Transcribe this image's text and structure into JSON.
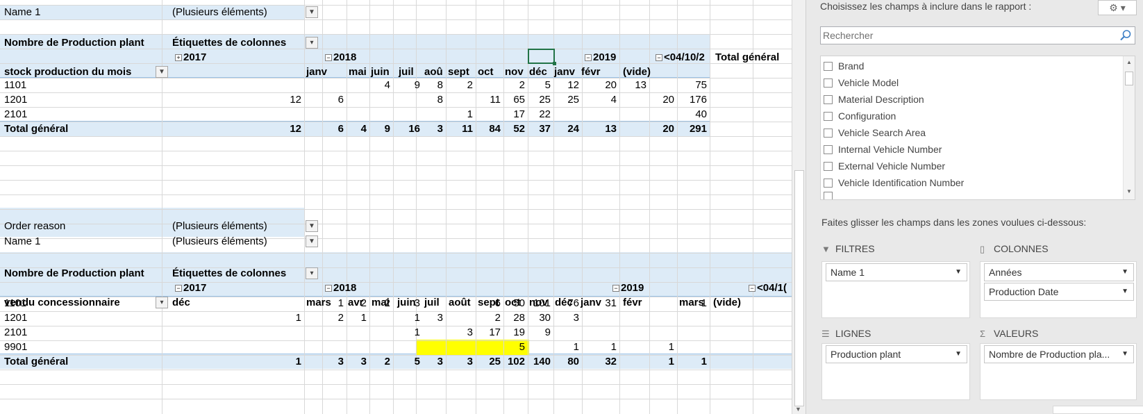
{
  "pivot1": {
    "filter_name": {
      "label": "Name 1",
      "value": "(Plusieurs éléments)"
    },
    "values_label": "Nombre de Production plant",
    "col_labels_caption": "Étiquettes de colonnes",
    "row_header": "stock production du mois",
    "years": {
      "y2017": "2017",
      "y2018": "2018",
      "y2019": "2019",
      "date": "<04/10/2",
      "total": "Total général"
    },
    "months": [
      "janv",
      "mai",
      "juin",
      "juil",
      "aoû",
      "sept",
      "oct",
      "nov",
      "déc",
      "janv",
      "févr",
      "(vide)"
    ],
    "rows": [
      {
        "label": "1101",
        "cells": [
          "",
          "",
          "",
          "4",
          "9",
          "8",
          "2",
          "",
          "2",
          "5",
          "12",
          "20",
          "13",
          "",
          "75"
        ]
      },
      {
        "label": "1201",
        "cells": [
          "12",
          "6",
          "",
          "",
          "",
          "8",
          "",
          "11",
          "65",
          "25",
          "25",
          "4",
          "",
          "20",
          "176"
        ]
      },
      {
        "label": "2101",
        "cells": [
          "",
          "",
          "",
          "",
          "",
          "",
          "1",
          "",
          "17",
          "22",
          "",
          "",
          "",
          "",
          "40"
        ]
      }
    ],
    "total": {
      "label": "Total général",
      "cells": [
        "12",
        "6",
        "4",
        "9",
        "16",
        "3",
        "11",
        "84",
        "52",
        "37",
        "24",
        "13",
        "",
        "20",
        "291"
      ]
    }
  },
  "pivot2": {
    "filter_order": {
      "label": "Order reason",
      "value": "(Plusieurs éléments)"
    },
    "filter_name": {
      "label": "Name 1",
      "value": "(Plusieurs éléments)"
    },
    "values_label": "Nombre de Production plant",
    "col_labels_caption": "Étiquettes de colonnes",
    "row_header": "vendu concessionnaire",
    "years": {
      "y2017": "2017",
      "y2018": "2018",
      "y2019": "2019",
      "date": "<04/1("
    },
    "months": [
      "déc",
      "mars",
      "avr",
      "mai",
      "juin",
      "juil",
      "août",
      "sept",
      "oct",
      "nov",
      "déc",
      "janv",
      "févr",
      "mars",
      "(vide)"
    ],
    "rows": [
      {
        "label": "1101",
        "cells": [
          "",
          "",
          "1",
          "2",
          "2",
          "3",
          "",
          "",
          "6",
          "50",
          "101",
          "76",
          "31",
          "",
          "1"
        ]
      },
      {
        "label": "1201",
        "cells": [
          "1",
          "",
          "2",
          "1",
          "",
          "1",
          "3",
          "",
          "2",
          "28",
          "30",
          "3",
          "",
          "",
          ""
        ]
      },
      {
        "label": "2101",
        "cells": [
          "",
          "",
          "",
          "",
          "",
          "1",
          "",
          "3",
          "17",
          "19",
          "9",
          "",
          "",
          "",
          ""
        ]
      },
      {
        "label": "9901",
        "cells": [
          "",
          "",
          "",
          "",
          "",
          "",
          "",
          "",
          "",
          "5",
          "",
          "1",
          "1",
          "1",
          ""
        ]
      }
    ],
    "total": {
      "label": "Total général",
      "cells": [
        "1",
        "",
        "3",
        "3",
        "2",
        "5",
        "3",
        "3",
        "25",
        "102",
        "140",
        "80",
        "32",
        "1",
        "1"
      ]
    }
  },
  "pane": {
    "choose_fields": "Choisissez les champs à inclure dans le rapport :",
    "search_placeholder": "Rechercher",
    "fields": [
      "Brand",
      "Vehicle Model",
      "Material Description",
      "Configuration",
      "Vehicle Search Area",
      "Internal Vehicle Number",
      "External Vehicle Number",
      "Vehicle Identification Number"
    ],
    "drag_hint": "Faites glisser les champs dans les zones voulues ci-dessous:",
    "zones": {
      "filters": {
        "title": "FILTRES",
        "items": [
          "Name 1"
        ]
      },
      "columns": {
        "title": "COLONNES",
        "items": [
          "Années",
          "Production Date"
        ]
      },
      "rows": {
        "title": "LIGNES",
        "items": [
          "Production plant"
        ]
      },
      "values": {
        "title": "VALEURS",
        "items": [
          "Nombre de Production pla..."
        ]
      }
    }
  },
  "colors": {
    "pivot_band": "#ddebf7",
    "highlight": "#ffff00",
    "selection": "#217346"
  }
}
